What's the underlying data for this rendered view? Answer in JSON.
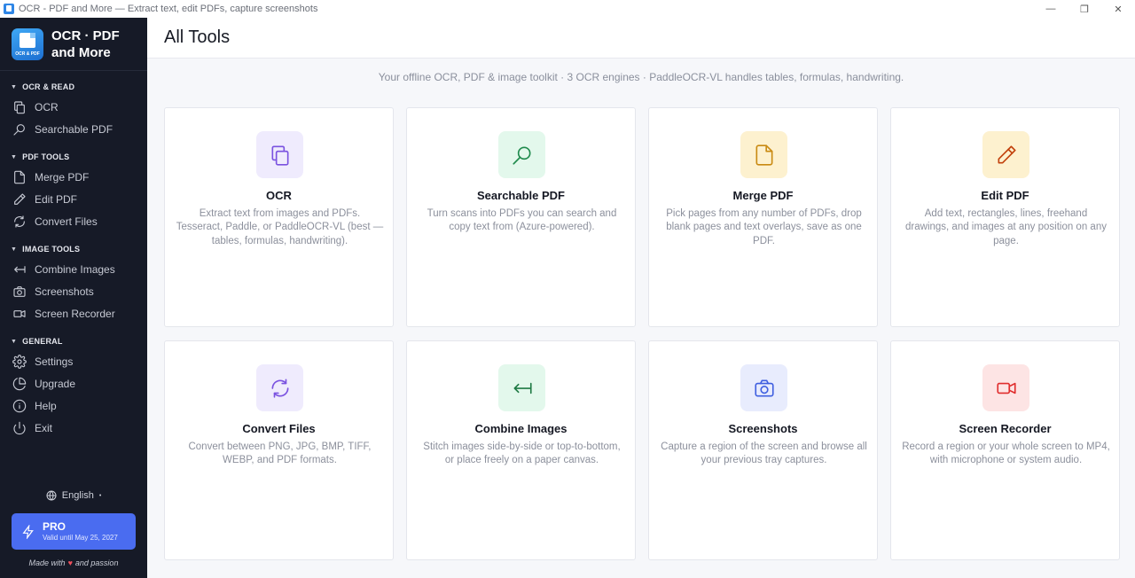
{
  "window": {
    "title": "OCR - PDF and More — Extract text, edit PDFs, capture screenshots",
    "controls": {
      "minimize": "—",
      "restore": "❐",
      "close": "✕"
    }
  },
  "sidebar": {
    "brand": "OCR · PDF and More",
    "brand_icon_tag": "OCR & PDF",
    "sections": [
      {
        "title": "OCR & READ",
        "items": [
          {
            "label": "OCR",
            "icon": "copy-icon"
          },
          {
            "label": "Searchable PDF",
            "icon": "search-icon"
          }
        ]
      },
      {
        "title": "PDF TOOLS",
        "items": [
          {
            "label": "Merge PDF",
            "icon": "file-icon"
          },
          {
            "label": "Edit PDF",
            "icon": "pencil-icon"
          },
          {
            "label": "Convert Files",
            "icon": "refresh-icon"
          }
        ]
      },
      {
        "title": "IMAGE TOOLS",
        "items": [
          {
            "label": "Combine Images",
            "icon": "arrow-left-bar-icon"
          },
          {
            "label": "Screenshots",
            "icon": "camera-icon"
          },
          {
            "label": "Screen Recorder",
            "icon": "video-icon"
          }
        ]
      },
      {
        "title": "GENERAL",
        "items": [
          {
            "label": "Settings",
            "icon": "gear-icon"
          },
          {
            "label": "Upgrade",
            "icon": "pie-icon"
          },
          {
            "label": "Help",
            "icon": "info-icon"
          },
          {
            "label": "Exit",
            "icon": "power-icon"
          }
        ]
      }
    ],
    "language": "English",
    "language_dot": "•",
    "pro": {
      "title": "PRO",
      "subtitle": "Valid until May 25, 2027"
    },
    "footer": {
      "before": "Made with",
      "heart": "♥",
      "after": "and passion"
    }
  },
  "main": {
    "title": "All Tools",
    "subtitle": "Your offline OCR, PDF & image toolkit  ·  3 OCR engines  ·  PaddleOCR-VL handles tables, formulas, handwriting.",
    "cards": [
      {
        "title": "OCR",
        "desc": "Extract text from images and PDFs. Tesseract, Paddle, or PaddleOCR-VL (best — tables, formulas, handwriting).",
        "icon": "copy-icon",
        "bg": "#efebfd",
        "fg": "#7a52e0"
      },
      {
        "title": "Searchable PDF",
        "desc": "Turn scans into PDFs you can search and copy text from (Azure-powered).",
        "icon": "search-icon",
        "bg": "#e3f8ec",
        "fg": "#1f8a4c"
      },
      {
        "title": "Merge PDF",
        "desc": "Pick pages from any number of PDFs, drop blank pages and text overlays, save as one PDF.",
        "icon": "file-icon",
        "bg": "#fdf1cf",
        "fg": "#c98a12"
      },
      {
        "title": "Edit PDF",
        "desc": "Add text, rectangles, lines, freehand drawings, and images at any position on any page.",
        "icon": "pencil-icon",
        "bg": "#fdf1cf",
        "fg": "#c2410c"
      },
      {
        "title": "Convert Files",
        "desc": "Convert between PNG, JPG, BMP, TIFF, WEBP, and PDF formats.",
        "icon": "refresh-icon",
        "bg": "#efebfd",
        "fg": "#7a52e0"
      },
      {
        "title": "Combine Images",
        "desc": "Stitch images side-by-side or top-to-bottom, or place freely on a paper canvas.",
        "icon": "arrow-left-bar-icon",
        "bg": "#e3f8ec",
        "fg": "#1f7a44"
      },
      {
        "title": "Screenshots",
        "desc": "Capture a region of the screen and browse all your previous tray captures.",
        "icon": "camera-icon",
        "bg": "#e8ecfd",
        "fg": "#3f5fe0"
      },
      {
        "title": "Screen Recorder",
        "desc": "Record a region or your whole screen to MP4, with microphone or system audio.",
        "icon": "video-icon",
        "bg": "#fde4e4",
        "fg": "#e02d2d"
      }
    ]
  }
}
